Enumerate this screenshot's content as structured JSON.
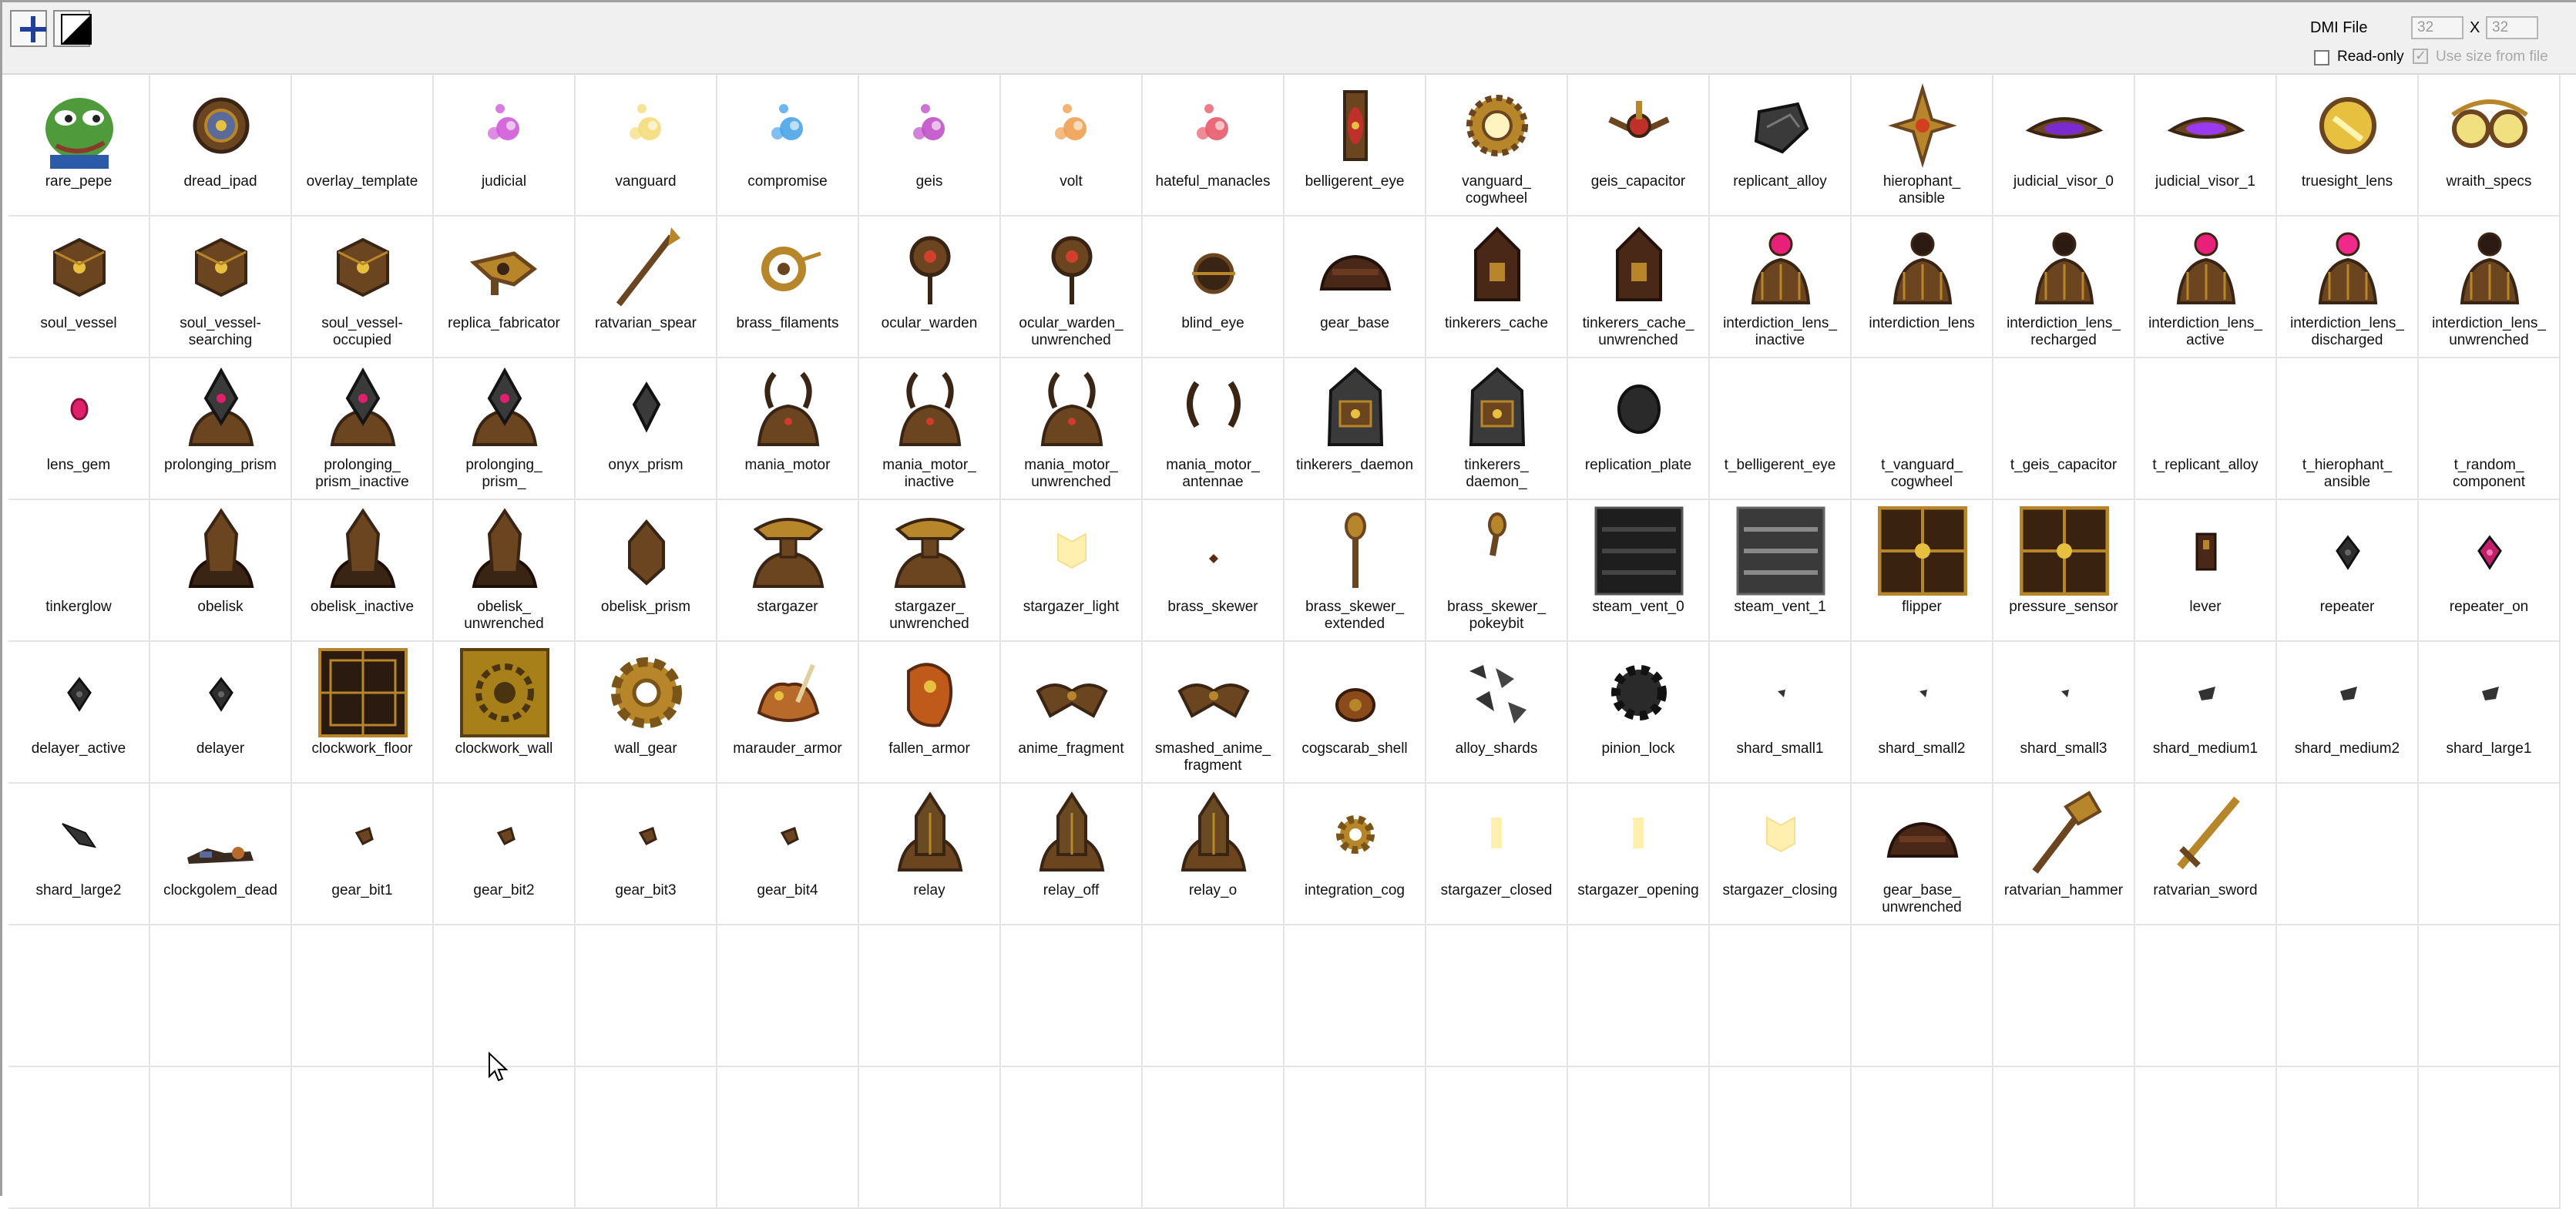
{
  "toolbar": {
    "dmi_label": "DMI File",
    "width_value": "32",
    "x_label": "X",
    "height_value": "32",
    "readonly_label": "Read-only",
    "usesize_label": "Use size from file",
    "usesize_checkmark": "✓"
  },
  "grid": {
    "columns": 18,
    "rows": 8,
    "states": [
      {
        "label": "rare_pepe",
        "kind": "pepe"
      },
      {
        "label": "dread_ipad",
        "kind": "ipad"
      },
      {
        "label": "overlay_template",
        "kind": "none"
      },
      {
        "label": "judicial",
        "kind": "wisp",
        "color": "#d05ad8"
      },
      {
        "label": "vanguard",
        "kind": "wisp",
        "color": "#f4dc7a"
      },
      {
        "label": "compromise",
        "kind": "wisp",
        "color": "#4aa4e8"
      },
      {
        "label": "geis",
        "kind": "wisp",
        "color": "#c050c8"
      },
      {
        "label": "volt",
        "kind": "wisp",
        "color": "#f0a050"
      },
      {
        "label": "hateful_manacles",
        "kind": "wisp",
        "color": "#e85a6a"
      },
      {
        "label": "belligerent_eye",
        "kind": "eye"
      },
      {
        "label": "vanguard_\ncogwheel",
        "kind": "ringgear"
      },
      {
        "label": "geis_capacitor",
        "kind": "capacitor"
      },
      {
        "label": "replicant_alloy",
        "kind": "alloy"
      },
      {
        "label": "hierophant_\nansible",
        "kind": "ansible"
      },
      {
        "label": "judicial_visor_0",
        "kind": "visor",
        "color": "#7a2ad0"
      },
      {
        "label": "judicial_visor_1",
        "kind": "visor",
        "color": "#9a3af0"
      },
      {
        "label": "truesight_lens",
        "kind": "lens"
      },
      {
        "label": "wraith_specs",
        "kind": "specs"
      },
      {
        "label": "soul_vessel",
        "kind": "cube"
      },
      {
        "label": "soul_vessel-\nsearching",
        "kind": "cube"
      },
      {
        "label": "soul_vessel-\noccupied",
        "kind": "cube"
      },
      {
        "label": "replica_fabricator",
        "kind": "fabricator"
      },
      {
        "label": "ratvarian_spear",
        "kind": "spear"
      },
      {
        "label": "brass_filaments",
        "kind": "filament"
      },
      {
        "label": "ocular_warden",
        "kind": "warden"
      },
      {
        "label": "ocular_warden_\nunwrenched",
        "kind": "warden"
      },
      {
        "label": "blind_eye",
        "kind": "blindeye"
      },
      {
        "label": "gear_base",
        "kind": "gearbase"
      },
      {
        "label": "tinkerers_cache",
        "kind": "cache"
      },
      {
        "label": "tinkerers_cache_\nunwrenched",
        "kind": "cache"
      },
      {
        "label": "interdiction_lens_\ninactive",
        "kind": "bell",
        "color": "#e8207a"
      },
      {
        "label": "interdiction_lens",
        "kind": "bell",
        "color": "#2a1a12"
      },
      {
        "label": "interdiction_lens_\nrecharged",
        "kind": "bell",
        "color": "#2a1a12"
      },
      {
        "label": "interdiction_lens_\nactive",
        "kind": "bell",
        "color": "#e8207a"
      },
      {
        "label": "interdiction_lens_\ndischarged",
        "kind": "bell",
        "color": "#f02a8a"
      },
      {
        "label": "interdiction_lens_\nunwrenched",
        "kind": "bell",
        "color": "#2a1a12"
      },
      {
        "label": "lens_gem",
        "kind": "gem"
      },
      {
        "label": "prolonging_prism",
        "kind": "prism"
      },
      {
        "label": "prolonging_\nprism_inactive",
        "kind": "prism"
      },
      {
        "label": "prolonging_\nprism_",
        "kind": "prism"
      },
      {
        "label": "onyx_prism",
        "kind": "onyx"
      },
      {
        "label": "mania_motor",
        "kind": "motor"
      },
      {
        "label": "mania_motor_\ninactive",
        "kind": "motor"
      },
      {
        "label": "mania_motor_\nunwrenched",
        "kind": "motor"
      },
      {
        "label": "mania_motor_\nantennae",
        "kind": "antennae"
      },
      {
        "label": "tinkerers_daemon",
        "kind": "daemon"
      },
      {
        "label": "tinkerers_\ndaemon_",
        "kind": "daemon"
      },
      {
        "label": "replication_plate",
        "kind": "plate"
      },
      {
        "label": "t_belligerent_eye",
        "kind": "none"
      },
      {
        "label": "t_vanguard_\ncogwheel",
        "kind": "none"
      },
      {
        "label": "t_geis_capacitor",
        "kind": "none"
      },
      {
        "label": "t_replicant_alloy",
        "kind": "none"
      },
      {
        "label": "t_hierophant_\nansible",
        "kind": "none"
      },
      {
        "label": "t_random_\ncomponent",
        "kind": "none"
      },
      {
        "label": "tinkerglow",
        "kind": "none"
      },
      {
        "label": "obelisk",
        "kind": "obelisk"
      },
      {
        "label": "obelisk_inactive",
        "kind": "obelisk"
      },
      {
        "label": "obelisk_\nunwrenched",
        "kind": "obelisk"
      },
      {
        "label": "obelisk_prism",
        "kind": "obprism"
      },
      {
        "label": "stargazer",
        "kind": "stargazer"
      },
      {
        "label": "stargazer_\nunwrenched",
        "kind": "stargazer"
      },
      {
        "label": "stargazer_light",
        "kind": "light"
      },
      {
        "label": "brass_skewer",
        "kind": "dot"
      },
      {
        "label": "brass_skewer_\nextended",
        "kind": "skewer"
      },
      {
        "label": "brass_skewer_\npokeybit",
        "kind": "pokey"
      },
      {
        "label": "steam_vent_0",
        "kind": "vent"
      },
      {
        "label": "steam_vent_1",
        "kind": "vent1"
      },
      {
        "label": "flipper",
        "kind": "tile"
      },
      {
        "label": "pressure_sensor",
        "kind": "tile"
      },
      {
        "label": "lever",
        "kind": "lever"
      },
      {
        "label": "repeater",
        "kind": "diamond",
        "color": "#2e2e2e"
      },
      {
        "label": "repeater_on",
        "kind": "diamond",
        "color": "#c0206a"
      },
      {
        "label": "delayer_active",
        "kind": "diamond",
        "color": "#2e2e2e"
      },
      {
        "label": "delayer",
        "kind": "diamond",
        "color": "#2e2e2e"
      },
      {
        "label": "clockwork_floor",
        "kind": "floor"
      },
      {
        "label": "clockwork_wall",
        "kind": "wall"
      },
      {
        "label": "wall_gear",
        "kind": "bigcog"
      },
      {
        "label": "marauder_armor",
        "kind": "armor"
      },
      {
        "label": "fallen_armor",
        "kind": "fallen"
      },
      {
        "label": "anime_fragment",
        "kind": "fragment"
      },
      {
        "label": "smashed_anime_\nfragment",
        "kind": "fragment"
      },
      {
        "label": "cogscarab_shell",
        "kind": "scarab"
      },
      {
        "label": "alloy_shards",
        "kind": "shards"
      },
      {
        "label": "pinion_lock",
        "kind": "pinion"
      },
      {
        "label": "shard_small1",
        "kind": "tinyshard"
      },
      {
        "label": "shard_small2",
        "kind": "tinyshard"
      },
      {
        "label": "shard_small3",
        "kind": "tinyshard"
      },
      {
        "label": "shard_medium1",
        "kind": "midshard"
      },
      {
        "label": "shard_medium2",
        "kind": "midshard"
      },
      {
        "label": "shard_large1",
        "kind": "midshard"
      },
      {
        "label": "shard_large2",
        "kind": "bigshard"
      },
      {
        "label": "clockgolem_dead",
        "kind": "golem"
      },
      {
        "label": "gear_bit1",
        "kind": "bit"
      },
      {
        "label": "gear_bit2",
        "kind": "bit"
      },
      {
        "label": "gear_bit3",
        "kind": "bit"
      },
      {
        "label": "gear_bit4",
        "kind": "bit"
      },
      {
        "label": "relay",
        "kind": "relay"
      },
      {
        "label": "relay_off",
        "kind": "relay"
      },
      {
        "label": "relay_o",
        "kind": "relay"
      },
      {
        "label": "integration_cog",
        "kind": "smallcog"
      },
      {
        "label": "stargazer_closed",
        "kind": "slim"
      },
      {
        "label": "stargazer_opening",
        "kind": "slim"
      },
      {
        "label": "stargazer_closing",
        "kind": "light"
      },
      {
        "label": "gear_base_\nunwrenched",
        "kind": "gearbase"
      },
      {
        "label": "ratvarian_hammer",
        "kind": "hammer"
      },
      {
        "label": "ratvarian_sword",
        "kind": "sword"
      }
    ]
  }
}
